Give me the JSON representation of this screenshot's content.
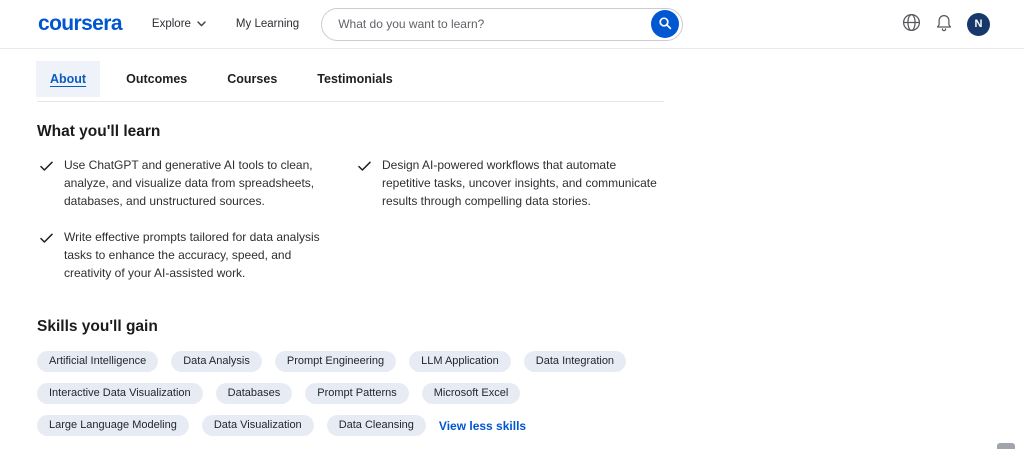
{
  "header": {
    "logo": "coursera",
    "explore_label": "Explore",
    "my_learning_label": "My Learning",
    "search_placeholder": "What do you want to learn?",
    "avatar_initial": "N"
  },
  "tabs": [
    {
      "label": "About",
      "active": true
    },
    {
      "label": "Outcomes",
      "active": false
    },
    {
      "label": "Courses",
      "active": false
    },
    {
      "label": "Testimonials",
      "active": false
    }
  ],
  "learn": {
    "title": "What you'll learn",
    "items": [
      "Use ChatGPT and generative AI tools to clean, analyze, and visualize data from spreadsheets, databases, and unstructured sources.",
      "Design AI-powered workflows that automate repetitive tasks, uncover insights, and communicate results through compelling data stories.",
      "Write effective prompts tailored for data analysis tasks to enhance the accuracy, speed, and creativity of your AI-assisted work."
    ]
  },
  "skills": {
    "title": "Skills you'll gain",
    "chips": [
      "Artificial Intelligence",
      "Data Analysis",
      "Prompt Engineering",
      "LLM Application",
      "Data Integration",
      "Interactive Data Visualization",
      "Databases",
      "Prompt Patterns",
      "Microsoft Excel",
      "Large Language Modeling",
      "Data Visualization",
      "Data Cleansing"
    ],
    "view_less_label": "View less skills"
  },
  "colors": {
    "brand_blue": "#0056D2",
    "chip_bg": "#e7ecf4",
    "avatar_bg": "#17386a",
    "text_dark": "#1f1f1f"
  }
}
